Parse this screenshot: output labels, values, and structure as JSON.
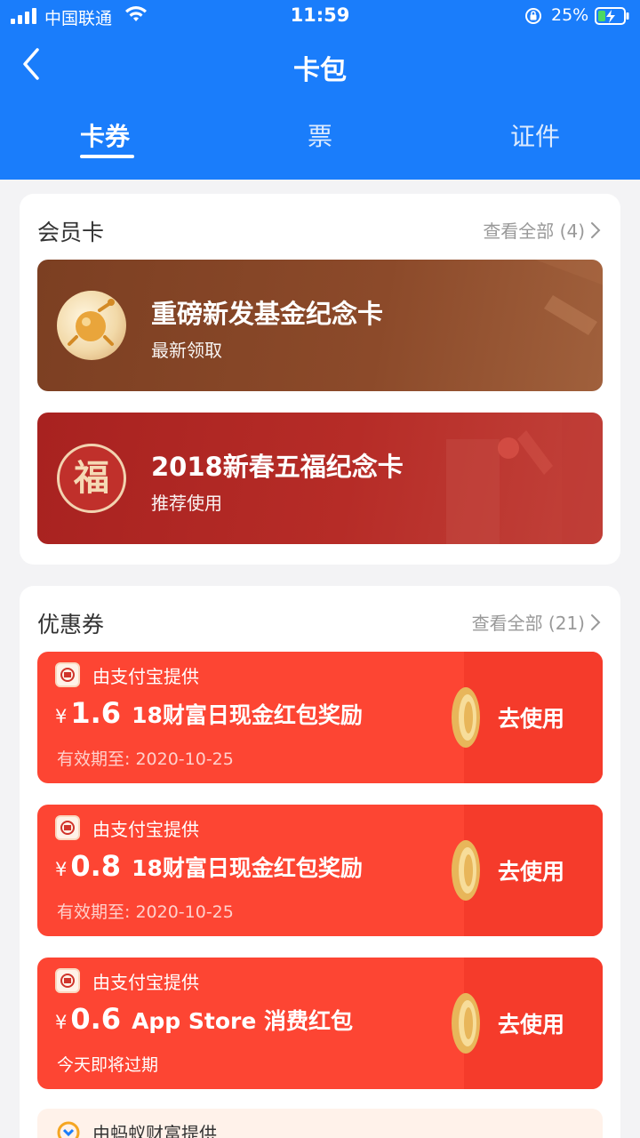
{
  "status_bar": {
    "carrier": "中国联通",
    "time": "11:59",
    "battery": "25%"
  },
  "nav": {
    "title": "卡包"
  },
  "tabs": [
    {
      "label": "卡券"
    },
    {
      "label": "票"
    },
    {
      "label": "证件"
    }
  ],
  "member_section": {
    "title": "会员卡",
    "more": "查看全部 (4)",
    "cards": [
      {
        "name": "重磅新发基金纪念卡",
        "subtitle": "最新领取",
        "color": "#8b4a2b"
      },
      {
        "name": "2018新春五福纪念卡",
        "subtitle": "推荐使用",
        "color": "#b42a26",
        "logo_char": "福"
      }
    ]
  },
  "coupon_section": {
    "title": "优惠券",
    "more": "查看全部 (21)",
    "coupons": [
      {
        "provider": "由支付宝提供",
        "currency": "¥",
        "amount": "1.6",
        "desc": "18财富日现金红包奖励",
        "expire": "有效期至: 2020-10-25",
        "action": "去使用"
      },
      {
        "provider": "由支付宝提供",
        "currency": "¥",
        "amount": "0.8",
        "desc": "18财富日现金红包奖励",
        "expire": "有效期至: 2020-10-25",
        "action": "去使用"
      },
      {
        "provider": "由支付宝提供",
        "currency": "¥",
        "amount": "0.6",
        "desc": "App Store 消费红包",
        "expire": "今天即将过期",
        "action": "去使用"
      }
    ],
    "partial_provider": "由蚂蚁财富提供"
  },
  "colors": {
    "header_blue": "#1a7dfb",
    "coupon_red": "#fd4533"
  }
}
